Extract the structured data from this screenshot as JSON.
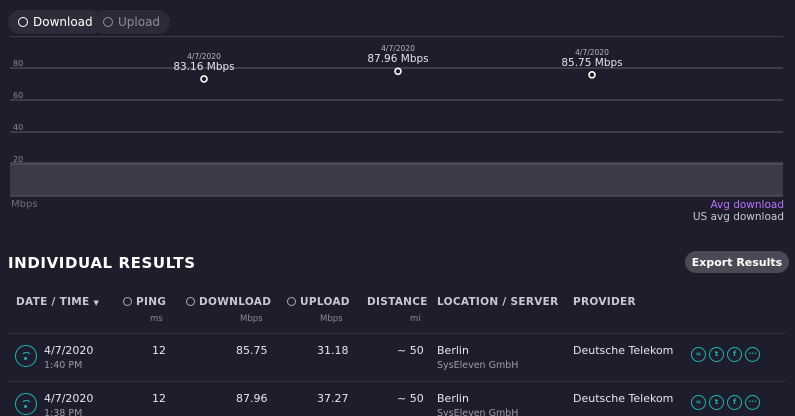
{
  "tabs": {
    "download": "Download",
    "upload": "Upload"
  },
  "chart_data": {
    "type": "line",
    "ylabel": "Mbps",
    "ylim": [
      0,
      100
    ],
    "yticks": [
      20,
      40,
      60,
      80
    ],
    "points": [
      {
        "date": "4/7/2020",
        "value": 83.16,
        "label": "83.16 Mbps"
      },
      {
        "date": "4/7/2020",
        "value": 87.96,
        "label": "87.96 Mbps"
      },
      {
        "date": "4/7/2020",
        "value": 85.75,
        "label": "85.75 Mbps"
      }
    ],
    "legend": {
      "avg": "Avg download",
      "us_avg": "US avg download"
    },
    "colors": {
      "avg": "#b575ff",
      "accent": "#1fb5b4"
    }
  },
  "section_title": "INDIVIDUAL RESULTS",
  "export_label": "Export Results",
  "columns": {
    "date": "DATE / TIME",
    "ping": "PING",
    "ping_unit": "ms",
    "download": "DOWNLOAD",
    "download_unit": "Mbps",
    "upload": "UPLOAD",
    "upload_unit": "Mbps",
    "distance": "DISTANCE",
    "distance_unit": "mi",
    "location": "LOCATION / SERVER",
    "provider": "PROVIDER"
  },
  "rows": [
    {
      "date": "4/7/2020",
      "time": "1:40 PM",
      "ping": "12",
      "download": "85.75",
      "upload": "31.18",
      "distance": "~ 50",
      "location": "Berlin",
      "server": "SysEleven GmbH",
      "provider": "Deutsche Telekom"
    },
    {
      "date": "4/7/2020",
      "time": "1:38 PM",
      "ping": "12",
      "download": "87.96",
      "upload": "37.27",
      "distance": "~ 50",
      "location": "Berlin",
      "server": "SysEleven GmbH",
      "provider": "Deutsche Telekom"
    }
  ]
}
